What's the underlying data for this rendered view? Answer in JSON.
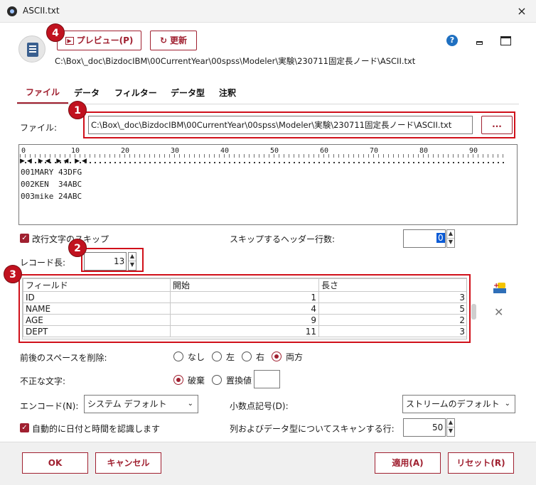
{
  "window": {
    "title": "ASCII.txt",
    "close_icon": "×"
  },
  "toolbar": {
    "preview_label": "プレビュー(P)",
    "refresh_label": "更新"
  },
  "path": "C:\\Box\\_doc\\BizdocIBM\\00CurrentYear\\00spss\\Modeler\\実験\\230711固定長ノード\\ASCII.txt",
  "tabs": [
    "ファイル",
    "データ",
    "フィルター",
    "データ型",
    "注釈"
  ],
  "file": {
    "label": "ファイル:",
    "value": "C:\\Box\\_doc\\BizdocIBM\\00CurrentYear\\00spss\\Modeler\\実験\\230711固定長ノード\\ASCII.txt",
    "browse_label": "..."
  },
  "ruler": {
    "ticks": [
      "0",
      "10",
      "20",
      "30",
      "40",
      "50",
      "60",
      "70",
      "80",
      "90"
    ]
  },
  "preview_lines": [
    "001MARY 43DFG",
    "002KEN  34ABC",
    "003mike 24ABC"
  ],
  "skip_newline": {
    "label": "改行文字のスキップ",
    "checked": true
  },
  "header_skip": {
    "label": "スキップするヘッダー行数:",
    "value": "0"
  },
  "record_length": {
    "label": "レコード長:",
    "value": "13"
  },
  "badges": {
    "b1": "1",
    "b2": "2",
    "b3": "3",
    "b4": "4"
  },
  "fields_table": {
    "columns": [
      "フィールド",
      "開始",
      "長さ"
    ],
    "rows": [
      [
        "ID",
        "1",
        "3"
      ],
      [
        "NAME",
        "4",
        "5"
      ],
      [
        "AGE",
        "9",
        "2"
      ],
      [
        "DEPT",
        "11",
        "3"
      ]
    ]
  },
  "trim": {
    "label": "前後のスペースを削除:",
    "options": [
      "なし",
      "左",
      "右",
      "両方"
    ],
    "selected": "両方"
  },
  "invalid": {
    "label": "不正な文字:",
    "options": [
      "破棄",
      "置換値"
    ],
    "selected": "破棄"
  },
  "encoding": {
    "label": "エンコード(N):",
    "value": "システム デフォルト"
  },
  "decimal": {
    "label": "小数点記号(D):",
    "value": "ストリームのデフォルト"
  },
  "auto_date": {
    "label": "自動的に日付と時間を認識します",
    "checked": true
  },
  "scan_rows": {
    "label": "列およびデータ型についてスキャンする行:",
    "value": "50"
  },
  "footer": {
    "ok": "OK",
    "cancel": "キャンセル",
    "apply": "適用(A)",
    "reset": "リセット(R)"
  },
  "colors": {
    "accent": "#a02030",
    "badge": "#c1121f",
    "highlight": "#0a5bd6"
  }
}
